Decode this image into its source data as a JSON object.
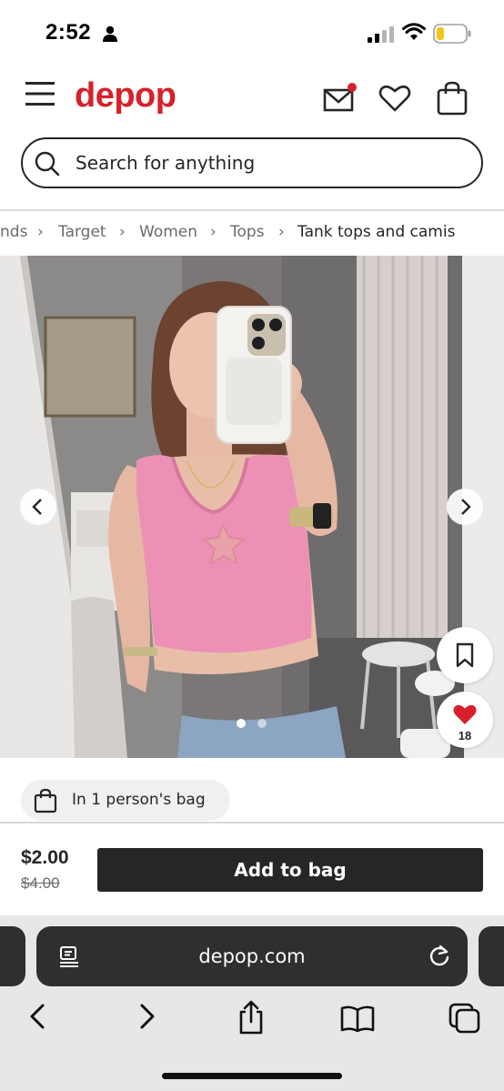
{
  "status_bar": {
    "time": "2:52"
  },
  "header": {
    "logo": "depop",
    "brand_color": "#d8202a",
    "icons": [
      "menu-icon",
      "mail-icon",
      "heart-icon",
      "bag-icon"
    ]
  },
  "search": {
    "placeholder": "Search for anything"
  },
  "breadcrumb": [
    {
      "label": "nds"
    },
    {
      "label": "Target"
    },
    {
      "label": "Women"
    },
    {
      "label": "Tops"
    },
    {
      "label": "Tank tops and camis"
    }
  ],
  "gallery": {
    "image_count": 2,
    "active_index": 0,
    "like_count": "18"
  },
  "bag_info": {
    "text": "In 1 person's bag"
  },
  "purchase": {
    "price": "$2.00",
    "original_price": "$4.00",
    "add_to_bag_label": "Add to bag"
  },
  "browser": {
    "url": "depop.com"
  }
}
